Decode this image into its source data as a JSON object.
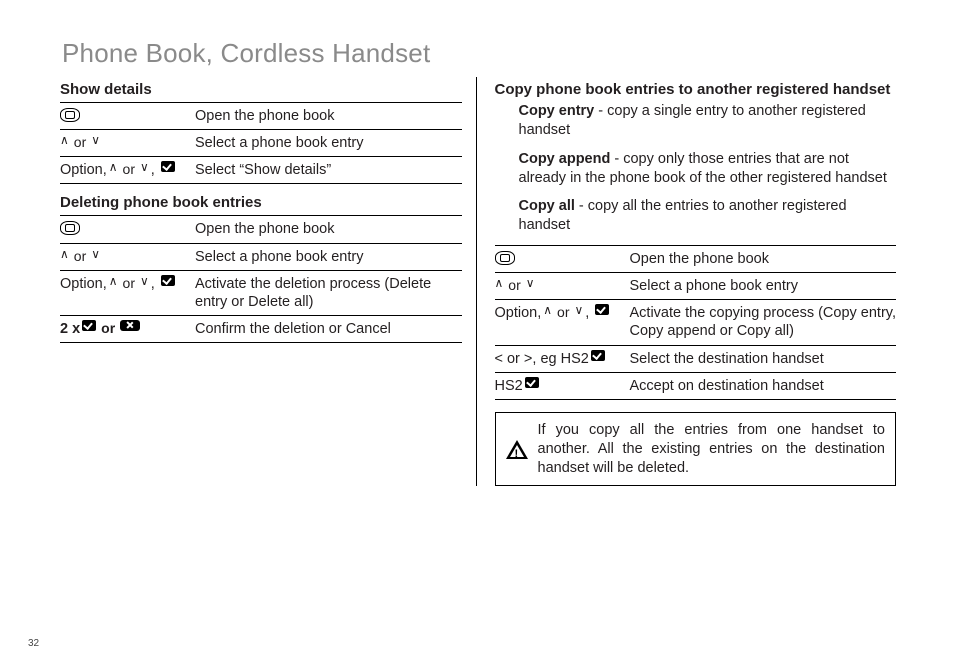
{
  "title": "Phone Book, Cordless Handset",
  "pageNumber": "32",
  "left": {
    "showDetails": {
      "heading": "Show details",
      "r1": "Open the phone book",
      "r2": "Select a phone book entry",
      "r3_prefix": "Option, ",
      "r3": "Select “Show details”"
    },
    "deleting": {
      "heading": "Deleting phone book entries",
      "r1": "Open the phone book",
      "r2": "Select a phone book entry",
      "r3_prefix": "Option, ",
      "r3": "Activate the deletion process (Delete entry or Delete all)",
      "r4_prefix": "2 x ",
      "r4": "Confirm the deletion or Cancel"
    },
    "or": "or"
  },
  "right": {
    "heading": "Copy phone book entries to another registered handset",
    "copyEntry": {
      "label": "Copy entry",
      "text": " - copy a single entry to another registered handset"
    },
    "copyAppend": {
      "label": "Copy append",
      "text": " - copy only those entries that are not already in the phone book of the other registered handset"
    },
    "copyAll": {
      "label": "Copy all",
      "text": " - copy all the entries to another registered handset"
    },
    "r1": "Open the phone book",
    "r2": "Select a phone book entry",
    "r3_prefix": "Option, ",
    "r3": "Activate the copying process (Copy entry, Copy append or Copy all)",
    "r4_key_a": "< or >, eg HS2 ",
    "r4": "Select the destination handset",
    "r5_key": "HS2 ",
    "r5": "Accept on destination handset",
    "or": "or",
    "warning": "If you copy all the entries from one handset to another. All the existing entries on the destination handset will be deleted."
  }
}
